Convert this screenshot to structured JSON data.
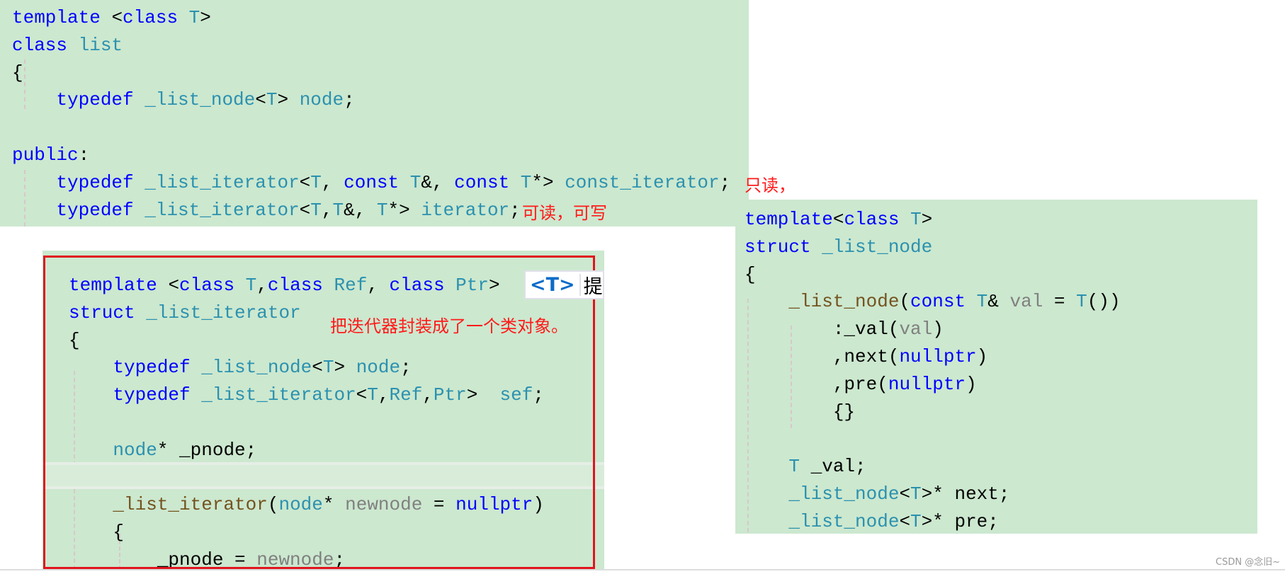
{
  "colors": {
    "background": "#cce8cf",
    "keyword": "#0000ff",
    "type": "#2b91af",
    "function": "#74531f",
    "parameter": "#808080",
    "annotation": "#ff1a1a",
    "box": "#e0141e"
  },
  "panels": {
    "list_class": [
      [
        [
          "template ",
          "kw"
        ],
        [
          "<",
          "tx"
        ],
        [
          "class ",
          "kw"
        ],
        [
          "T",
          "ty"
        ],
        [
          ">",
          "tx"
        ]
      ],
      [
        [
          "class ",
          "kw"
        ],
        [
          "list",
          "ty"
        ]
      ],
      [
        [
          "{",
          "tx"
        ]
      ],
      [
        [
          "    typedef ",
          "kw"
        ],
        [
          "_list_node",
          "ty"
        ],
        [
          "<",
          "tx"
        ],
        [
          "T",
          "ty"
        ],
        [
          "> ",
          "tx"
        ],
        [
          "node",
          "ty"
        ],
        [
          ";",
          "tx"
        ]
      ],
      [
        [
          "",
          ""
        ]
      ],
      [
        [
          "public",
          "kw"
        ],
        [
          ":",
          "tx"
        ]
      ],
      [
        [
          "    typedef ",
          "kw"
        ],
        [
          "_list_iterator",
          "ty"
        ],
        [
          "<",
          "tx"
        ],
        [
          "T",
          "ty"
        ],
        [
          ", ",
          "tx"
        ],
        [
          "const ",
          "kw"
        ],
        [
          "T",
          "ty"
        ],
        [
          "&, ",
          "tx"
        ],
        [
          "const ",
          "kw"
        ],
        [
          "T",
          "ty"
        ],
        [
          "*> ",
          "tx"
        ],
        [
          "const_iterator",
          "ty"
        ],
        [
          ";",
          "tx"
        ]
      ],
      [
        [
          "    typedef ",
          "kw"
        ],
        [
          "_list_iterator",
          "ty"
        ],
        [
          "<",
          "tx"
        ],
        [
          "T",
          "ty"
        ],
        [
          ",",
          "tx"
        ],
        [
          "T",
          "ty"
        ],
        [
          "&, ",
          "tx"
        ],
        [
          "T",
          "ty"
        ],
        [
          "*> ",
          "tx"
        ],
        [
          "iterator",
          "ty"
        ],
        [
          ";",
          "tx"
        ]
      ]
    ],
    "iterator_struct": [
      [
        [
          "template ",
          "kw"
        ],
        [
          "<",
          "tx"
        ],
        [
          "class ",
          "kw"
        ],
        [
          "T",
          "ty"
        ],
        [
          ",",
          "tx"
        ],
        [
          "class ",
          "kw"
        ],
        [
          "Ref",
          "ty"
        ],
        [
          ", ",
          "tx"
        ],
        [
          "class ",
          "kw"
        ],
        [
          "Ptr",
          "ty"
        ],
        [
          ">",
          "tx"
        ]
      ],
      [
        [
          "struct ",
          "kw"
        ],
        [
          "_list_iterator",
          "ty"
        ]
      ],
      [
        [
          "{",
          "tx"
        ]
      ],
      [
        [
          "    typedef ",
          "kw"
        ],
        [
          "_list_node",
          "ty"
        ],
        [
          "<",
          "tx"
        ],
        [
          "T",
          "ty"
        ],
        [
          "> ",
          "tx"
        ],
        [
          "node",
          "ty"
        ],
        [
          ";",
          "tx"
        ]
      ],
      [
        [
          "    typedef ",
          "kw"
        ],
        [
          "_list_iterator",
          "ty"
        ],
        [
          "<",
          "tx"
        ],
        [
          "T",
          "ty"
        ],
        [
          ",",
          "tx"
        ],
        [
          "Ref",
          "ty"
        ],
        [
          ",",
          "tx"
        ],
        [
          "Ptr",
          "ty"
        ],
        [
          ">  ",
          "tx"
        ],
        [
          "sef",
          "ty"
        ],
        [
          ";",
          "tx"
        ]
      ],
      [
        [
          "",
          ""
        ]
      ],
      [
        [
          "    node",
          "ty"
        ],
        [
          "* _pnode;",
          "tx"
        ]
      ],
      [
        [
          "",
          ""
        ]
      ],
      [
        [
          "    _list_iterator",
          "fn"
        ],
        [
          "(",
          "tx"
        ],
        [
          "node",
          "ty"
        ],
        [
          "* ",
          "tx"
        ],
        [
          "newnode",
          "pa"
        ],
        [
          " = ",
          "tx"
        ],
        [
          "nullptr",
          "kw"
        ],
        [
          ")",
          "tx"
        ]
      ],
      [
        [
          "    {",
          "tx"
        ]
      ],
      [
        [
          "        _pnode = ",
          "tx"
        ],
        [
          "newnode",
          "pa"
        ],
        [
          ";",
          "tx"
        ]
      ]
    ],
    "node_struct": [
      [
        [
          "template",
          "kw"
        ],
        [
          "<",
          "tx"
        ],
        [
          "class ",
          "kw"
        ],
        [
          "T",
          "ty"
        ],
        [
          ">",
          "tx"
        ]
      ],
      [
        [
          "struct ",
          "kw"
        ],
        [
          "_list_node",
          "ty"
        ]
      ],
      [
        [
          "{",
          "tx"
        ]
      ],
      [
        [
          "    _list_node",
          "fn"
        ],
        [
          "(",
          "tx"
        ],
        [
          "const ",
          "kw"
        ],
        [
          "T",
          "ty"
        ],
        [
          "& ",
          "tx"
        ],
        [
          "val",
          "pa"
        ],
        [
          " = ",
          "tx"
        ],
        [
          "T",
          "ty"
        ],
        [
          "())",
          "tx"
        ]
      ],
      [
        [
          "        :_val(",
          "tx"
        ],
        [
          "val",
          "pa"
        ],
        [
          ")",
          "tx"
        ]
      ],
      [
        [
          "        ,next(",
          "tx"
        ],
        [
          "nullptr",
          "kw"
        ],
        [
          ")",
          "tx"
        ]
      ],
      [
        [
          "        ,pre(",
          "tx"
        ],
        [
          "nullptr",
          "kw"
        ],
        [
          ")",
          "tx"
        ]
      ],
      [
        [
          "        {}",
          "tx"
        ]
      ],
      [
        [
          "",
          ""
        ]
      ],
      [
        [
          "    T",
          "ty"
        ],
        [
          " _val;",
          "tx"
        ]
      ],
      [
        [
          "    _list_node",
          "ty"
        ],
        [
          "<",
          "tx"
        ],
        [
          "T",
          "ty"
        ],
        [
          ">",
          "tx"
        ],
        [
          "* next;",
          "tx"
        ]
      ],
      [
        [
          "    _list_node",
          "ty"
        ],
        [
          "<",
          "tx"
        ],
        [
          "T",
          "ty"
        ],
        [
          ">",
          "tx"
        ],
        [
          "* pre;",
          "tx"
        ]
      ]
    ]
  },
  "annotations": {
    "read_only": "只读，",
    "read_write": "可读，可写",
    "iterator_note": "把迭代器封装成了一个类对象。"
  },
  "tooltip": {
    "tag": "<T>",
    "text": "提供"
  },
  "watermark": "CSDN @念旧~"
}
